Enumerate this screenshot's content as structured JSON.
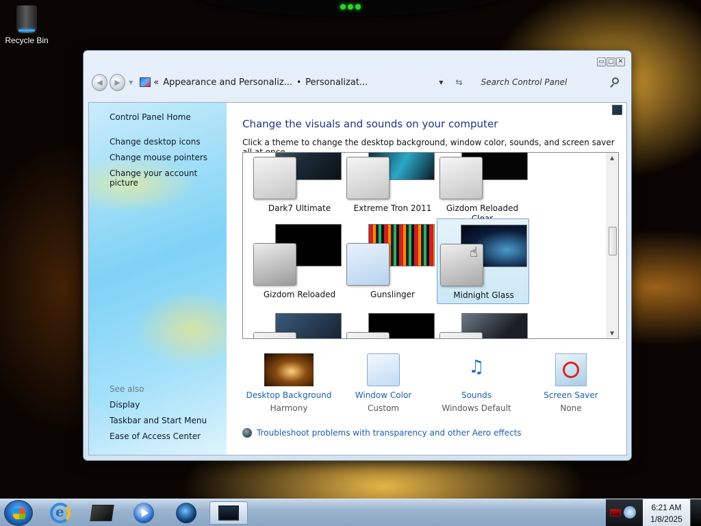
{
  "desktop": {
    "icons": [
      {
        "label": "Recycle Bin",
        "icon": "recycle-bin-icon"
      }
    ]
  },
  "window": {
    "caption_buttons": [
      "minimize",
      "maximize",
      "close"
    ],
    "address": {
      "crumbs": [
        "Appearance and Personaliz...",
        "Personalizat..."
      ],
      "prefix": "«",
      "separator": "•"
    },
    "search_placeholder": "Search Control Panel"
  },
  "sidebar": {
    "links": [
      "Control Panel Home",
      "Change desktop icons",
      "Change mouse pointers",
      "Change your account picture"
    ],
    "see_also_title": "See also",
    "see_also": [
      "Display",
      "Taskbar and Start Menu",
      "Ease of Access Center"
    ]
  },
  "main": {
    "title": "Change the visuals and sounds on your computer",
    "subtitle": "Click a theme to change the desktop background, window color, sounds, and screen saver all at once.",
    "themes": [
      {
        "name": "Dark7 Ultimate",
        "bg_color": "#1c2a38"
      },
      {
        "name": "Extreme Tron 2011",
        "bg_color": "#0b1a22"
      },
      {
        "name": "Gizdom Reloaded Clear",
        "bg_color": "#050505"
      },
      {
        "name": "Gizdom Reloaded",
        "bg_color": "#000000"
      },
      {
        "name": "Gunslinger",
        "bg_color": "#3a0d0d"
      },
      {
        "name": "Midnight Glass",
        "bg_color": "#0b1c3a",
        "selected": true
      },
      {
        "name": "",
        "bg_color": "#111a26"
      },
      {
        "name": "",
        "bg_color": "#000000"
      },
      {
        "name": "",
        "bg_color": "#1a1f26"
      }
    ],
    "settings": [
      {
        "label": "Desktop Background",
        "value": "Harmony",
        "icon": "desktop-background-thumbnail"
      },
      {
        "label": "Window Color",
        "value": "Custom",
        "icon": "window-color-swatch"
      },
      {
        "label": "Sounds",
        "value": "Windows Default",
        "icon": "sounds-icon"
      },
      {
        "label": "Screen Saver",
        "value": "None",
        "icon": "screen-saver-icon"
      }
    ],
    "troubleshoot_link": "Troubleshoot problems with transparency and other Aero effects"
  },
  "taskbar": {
    "items": [
      "internet-explorer-icon",
      "box-app-icon",
      "media-player-icon",
      "globe-app-icon",
      "personalization-window-icon"
    ],
    "clock": {
      "time": "6:21 AM",
      "date": "1/8/2025"
    }
  }
}
